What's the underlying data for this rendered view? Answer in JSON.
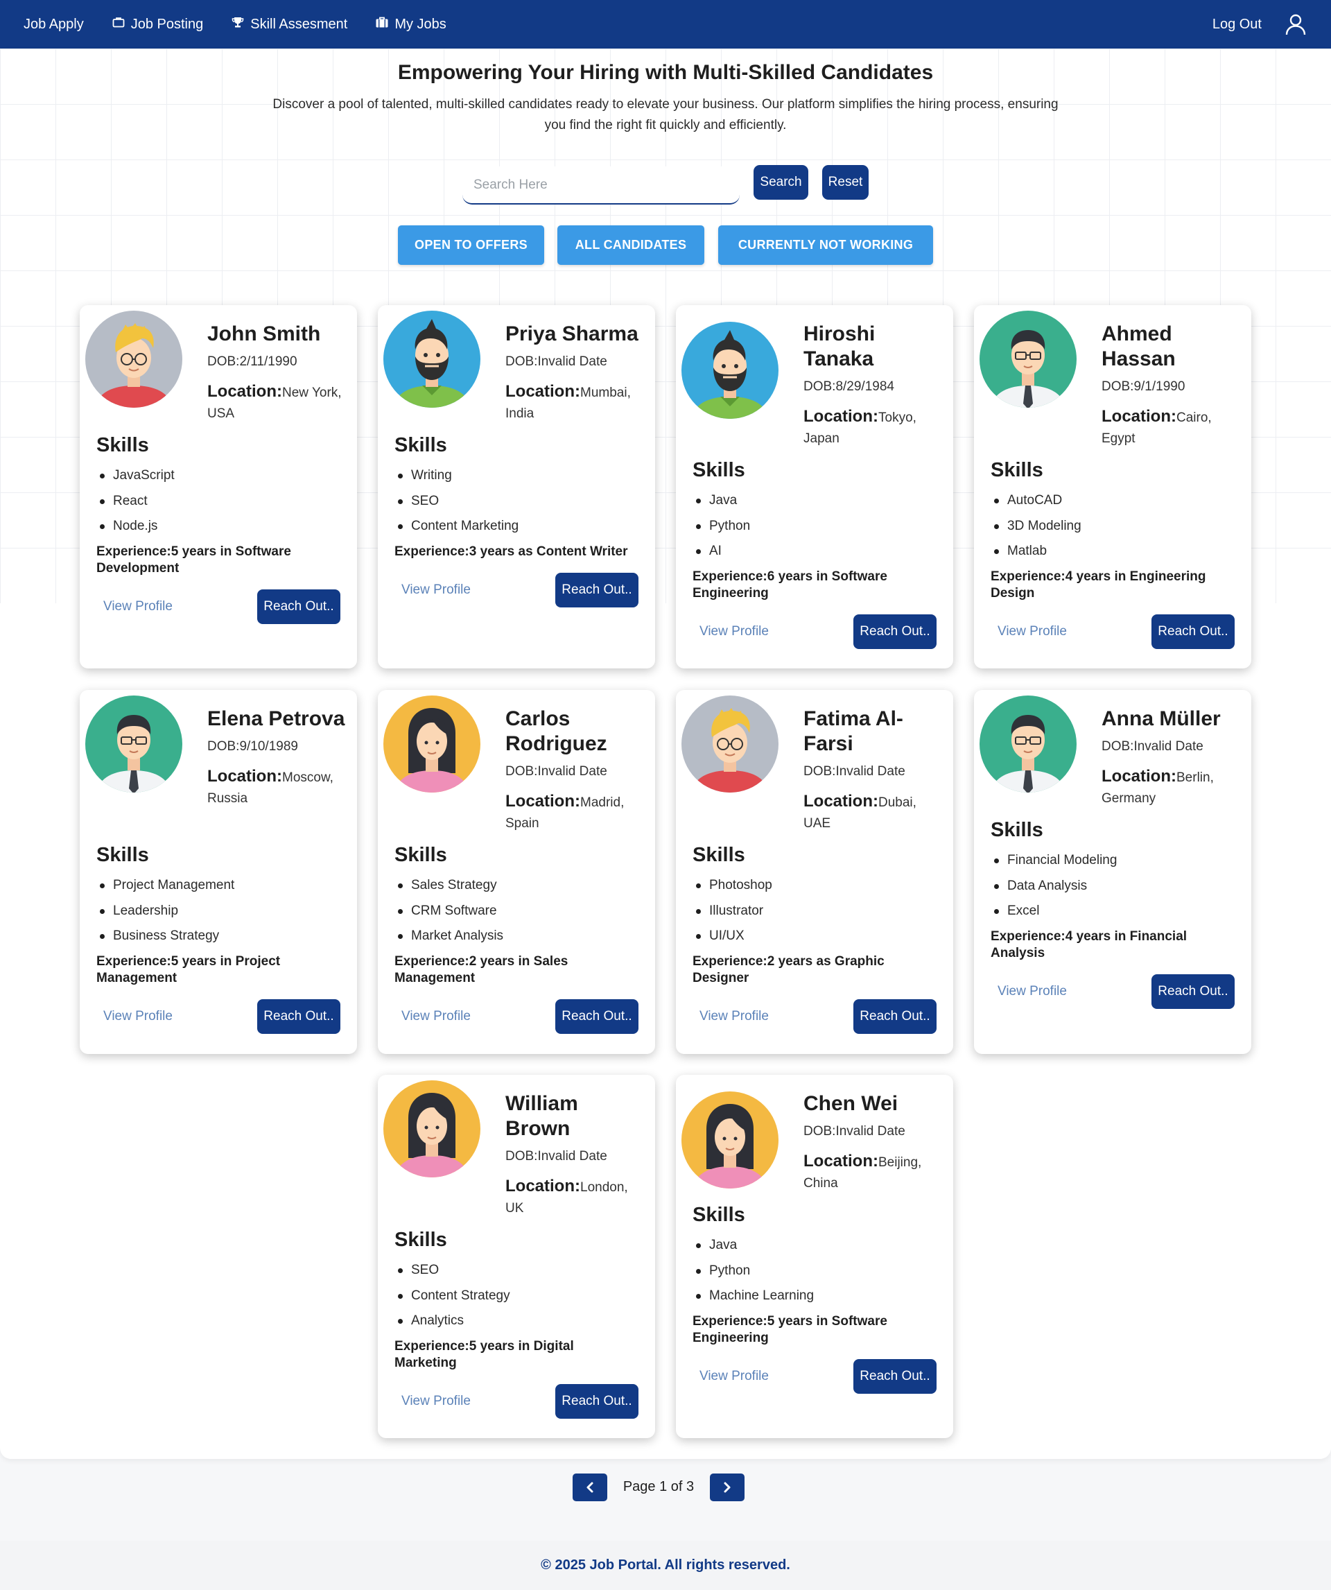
{
  "nav": {
    "items": [
      {
        "label": "Job Apply",
        "icon": "none"
      },
      {
        "label": "Job Posting",
        "icon": "briefcase-icon"
      },
      {
        "label": "Skill Assesment",
        "icon": "trophy-icon"
      },
      {
        "label": "My Jobs",
        "icon": "jobs-icon"
      }
    ],
    "logout": "Log Out",
    "user_icon": "user-icon"
  },
  "hero": {
    "title": "Empowering Your Hiring with Multi-Skilled Candidates",
    "description": "Discover a pool of talented, multi-skilled candidates ready to elevate your business. Our platform simplifies the hiring process, ensuring you find the right fit quickly and efficiently."
  },
  "search": {
    "placeholder": "Search Here",
    "value": "",
    "search_label": "Search",
    "reset_label": "Reset"
  },
  "filters": [
    "OPEN TO OFFERS",
    "ALL CANDIDATES",
    "CURRENTLY NOT WORKING"
  ],
  "card_labels": {
    "dob": "DOB:",
    "location": "Location:",
    "skills": "Skills",
    "experience": "Experience:",
    "view_profile": "View Profile",
    "reach_out": "Reach Out.."
  },
  "colors": {
    "brand": "#123a86",
    "filter": "#3b9ae6",
    "link": "#5b82b8"
  },
  "candidates": [
    {
      "name": "John Smith",
      "dob": "2/11/1990",
      "location": "New York, USA",
      "skills": [
        "JavaScript",
        "React",
        "Node.js"
      ],
      "experience": "5 years in Software Development",
      "avatar": "blond-man"
    },
    {
      "name": "Priya Sharma",
      "dob": "Invalid Date",
      "location": "Mumbai, India",
      "skills": [
        "Writing",
        "SEO",
        "Content Marketing"
      ],
      "experience": "3 years as Content Writer",
      "avatar": "bearded-man"
    },
    {
      "name": "Hiroshi Tanaka",
      "dob": "8/29/1984",
      "location": "Tokyo, Japan",
      "skills": [
        "Java",
        "Python",
        "AI"
      ],
      "experience": "6 years in Software Engineering",
      "avatar": "bearded-man"
    },
    {
      "name": "Ahmed Hassan",
      "dob": "9/1/1990",
      "location": "Cairo, Egypt",
      "skills": [
        "AutoCAD",
        "3D Modeling",
        "Matlab"
      ],
      "experience": "4 years in Engineering Design",
      "avatar": "tie-man"
    },
    {
      "name": "Elena Petrova",
      "dob": "9/10/1989",
      "location": "Moscow, Russia",
      "skills": [
        "Project Management",
        "Leadership",
        "Business Strategy"
      ],
      "experience": "5 years in Project Management",
      "avatar": "tie-man"
    },
    {
      "name": "Carlos Rodriguez",
      "dob": "Invalid Date",
      "location": "Madrid, Spain",
      "skills": [
        "Sales Strategy",
        "CRM Software",
        "Market Analysis"
      ],
      "experience": "2 years in Sales Management",
      "avatar": "woman"
    },
    {
      "name": "Fatima Al-Farsi",
      "dob": "Invalid Date",
      "location": "Dubai, UAE",
      "skills": [
        "Photoshop",
        "Illustrator",
        "UI/UX"
      ],
      "experience": "2 years as Graphic Designer",
      "avatar": "blond-man"
    },
    {
      "name": "Anna Müller",
      "dob": "Invalid Date",
      "location": "Berlin, Germany",
      "skills": [
        "Financial Modeling",
        "Data Analysis",
        "Excel"
      ],
      "experience": "4 years in Financial Analysis",
      "avatar": "tie-man"
    },
    {
      "name": "William Brown",
      "dob": "Invalid Date",
      "location": "London, UK",
      "skills": [
        "SEO",
        "Content Strategy",
        "Analytics"
      ],
      "experience": "5 years in Digital Marketing",
      "avatar": "woman"
    },
    {
      "name": "Chen Wei",
      "dob": "Invalid Date",
      "location": "Beijing, China",
      "skills": [
        "Java",
        "Python",
        "Machine Learning"
      ],
      "experience": "5 years in Software Engineering",
      "avatar": "woman"
    }
  ],
  "pagination": {
    "text": "Page 1 of 3",
    "current": 1,
    "total": 3
  },
  "footer": "© 2025 Job Portal. All rights reserved."
}
